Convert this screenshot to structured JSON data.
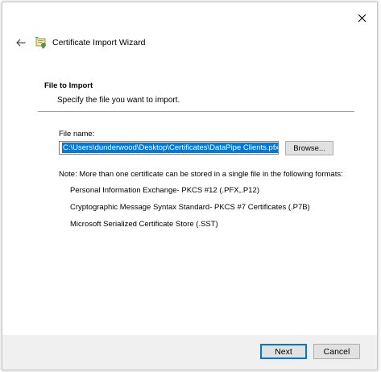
{
  "window": {
    "title": "Certificate Import Wizard",
    "close_icon": "close-icon",
    "back_icon": "back-arrow-icon",
    "wizard_icon": "certificate-icon"
  },
  "section": {
    "title": "File to Import",
    "subtitle": "Specify the file you want to import."
  },
  "file": {
    "label": "File name:",
    "value": "C:\\Users\\dunderwood\\Desktop\\Certificates\\DataPipe Clients.pfx",
    "browse_label": "Browse..."
  },
  "note": "Note:  More than one certificate can be stored in a single file in the following formats:",
  "formats": [
    "Personal Information Exchange- PKCS #12 (.PFX,.P12)",
    "Cryptographic Message Syntax Standard- PKCS #7 Certificates (.P7B)",
    "Microsoft Serialized Certificate Store (.SST)"
  ],
  "footer": {
    "next_label": "Next",
    "cancel_label": "Cancel"
  },
  "colors": {
    "accent": "#0078d7",
    "footer_bg": "#f0f0f0",
    "button_bg": "#e1e1e1"
  }
}
